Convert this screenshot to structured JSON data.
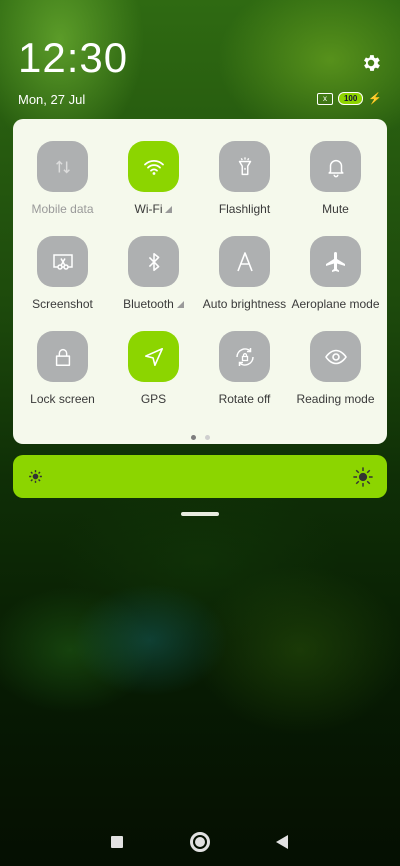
{
  "status": {
    "time": "12:30",
    "date": "Mon, 27 Jul",
    "battery": "100",
    "sim_icon": "x"
  },
  "tiles": [
    {
      "label": "Mobile data",
      "active": false,
      "dimmed": true,
      "icon": "mobile-data-icon"
    },
    {
      "label": "Wi-Fi",
      "active": true,
      "icon": "wifi-icon",
      "expand": true
    },
    {
      "label": "Flashlight",
      "active": false,
      "icon": "flashlight-icon"
    },
    {
      "label": "Mute",
      "active": false,
      "icon": "bell-icon"
    },
    {
      "label": "Screenshot",
      "active": false,
      "icon": "screenshot-icon"
    },
    {
      "label": "Bluetooth",
      "active": false,
      "icon": "bluetooth-icon",
      "expand": true
    },
    {
      "label": "Auto brightness",
      "active": false,
      "icon": "auto-brightness-icon"
    },
    {
      "label": "Aeroplane mode",
      "active": false,
      "icon": "aeroplane-icon"
    },
    {
      "label": "Lock screen",
      "active": false,
      "icon": "lock-icon"
    },
    {
      "label": "GPS",
      "active": true,
      "icon": "location-arrow-icon"
    },
    {
      "label": "Rotate off",
      "active": false,
      "icon": "rotate-lock-icon"
    },
    {
      "label": "Reading mode",
      "active": false,
      "icon": "eye-icon"
    }
  ],
  "pager": {
    "pages": 2,
    "current": 1
  },
  "colors": {
    "accent": "#8cd500",
    "tile_off": "#aeb0b1",
    "panel": "#f5f9ec"
  }
}
